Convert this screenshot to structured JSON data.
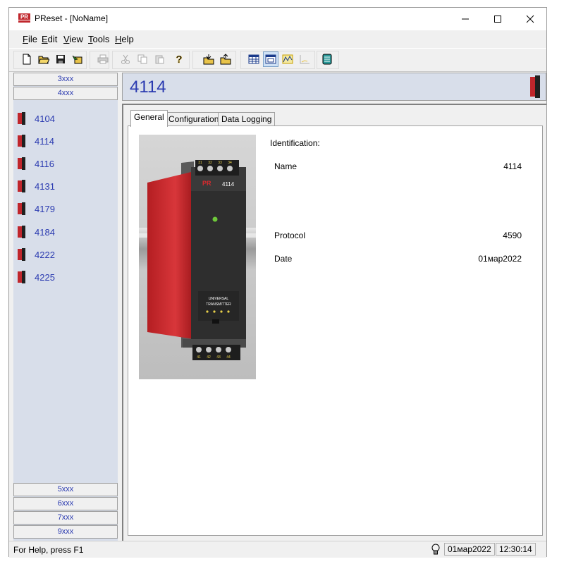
{
  "app": {
    "title": "PReset - [NoName]"
  },
  "menu": [
    {
      "label": "File",
      "ul": "F",
      "rest": "ile"
    },
    {
      "label": "Edit",
      "ul": "E",
      "rest": "dit"
    },
    {
      "label": "View",
      "ul": "V",
      "rest": "iew"
    },
    {
      "label": "Tools",
      "ul": "T",
      "rest": "ools"
    },
    {
      "label": "Help",
      "ul": "H",
      "rest": "elp"
    }
  ],
  "sidebar": {
    "groups_top": [
      "3xxx",
      "4xxx"
    ],
    "devices": [
      "4104",
      "4114",
      "4116",
      "4131",
      "4179",
      "4184",
      "4222",
      "4225"
    ],
    "groups_bottom": [
      "5xxx",
      "6xxx",
      "7xxx",
      "9xxx"
    ]
  },
  "main": {
    "title": "4114",
    "tabs": [
      "General",
      "Configuration",
      "Data Logging"
    ],
    "active_tab": "General",
    "identification": {
      "heading": "Identification:",
      "name_label": "Name",
      "name_value": "4114",
      "protocol_label": "Protocol",
      "protocol_value": "4590",
      "date_label": "Date",
      "date_value": "01мар2022"
    },
    "product_image": {
      "brand": "PR",
      "model": "4114",
      "line1": "UNIVERSAL",
      "line2": "TRANSMITTER",
      "top_terminals": [
        "31",
        "32",
        "33",
        "34"
      ],
      "bottom_terminals": [
        "41",
        "42",
        "43",
        "44"
      ]
    }
  },
  "status": {
    "help_text": "For Help, press F1",
    "date": "01мар2022",
    "time": "12:30:14"
  },
  "colors": {
    "accent_text": "#2a3ab0",
    "panel_bg": "#d8deea",
    "device_red": "#c0262c"
  }
}
